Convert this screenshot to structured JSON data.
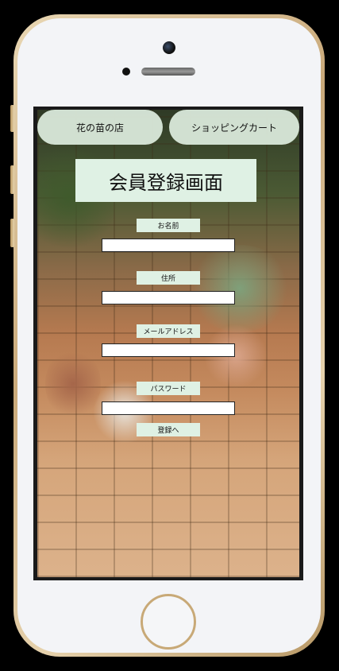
{
  "nav": {
    "shop_label": "花の苗の店",
    "cart_label": "ショッピングカート"
  },
  "page": {
    "title": "会員登録画面"
  },
  "form": {
    "name_label": "お名前",
    "address_label": "住所",
    "email_label": "メールアドレス",
    "password_label": "パスワード",
    "submit_label": "登録へ",
    "name_value": "",
    "address_value": "",
    "email_value": "",
    "password_value": ""
  }
}
